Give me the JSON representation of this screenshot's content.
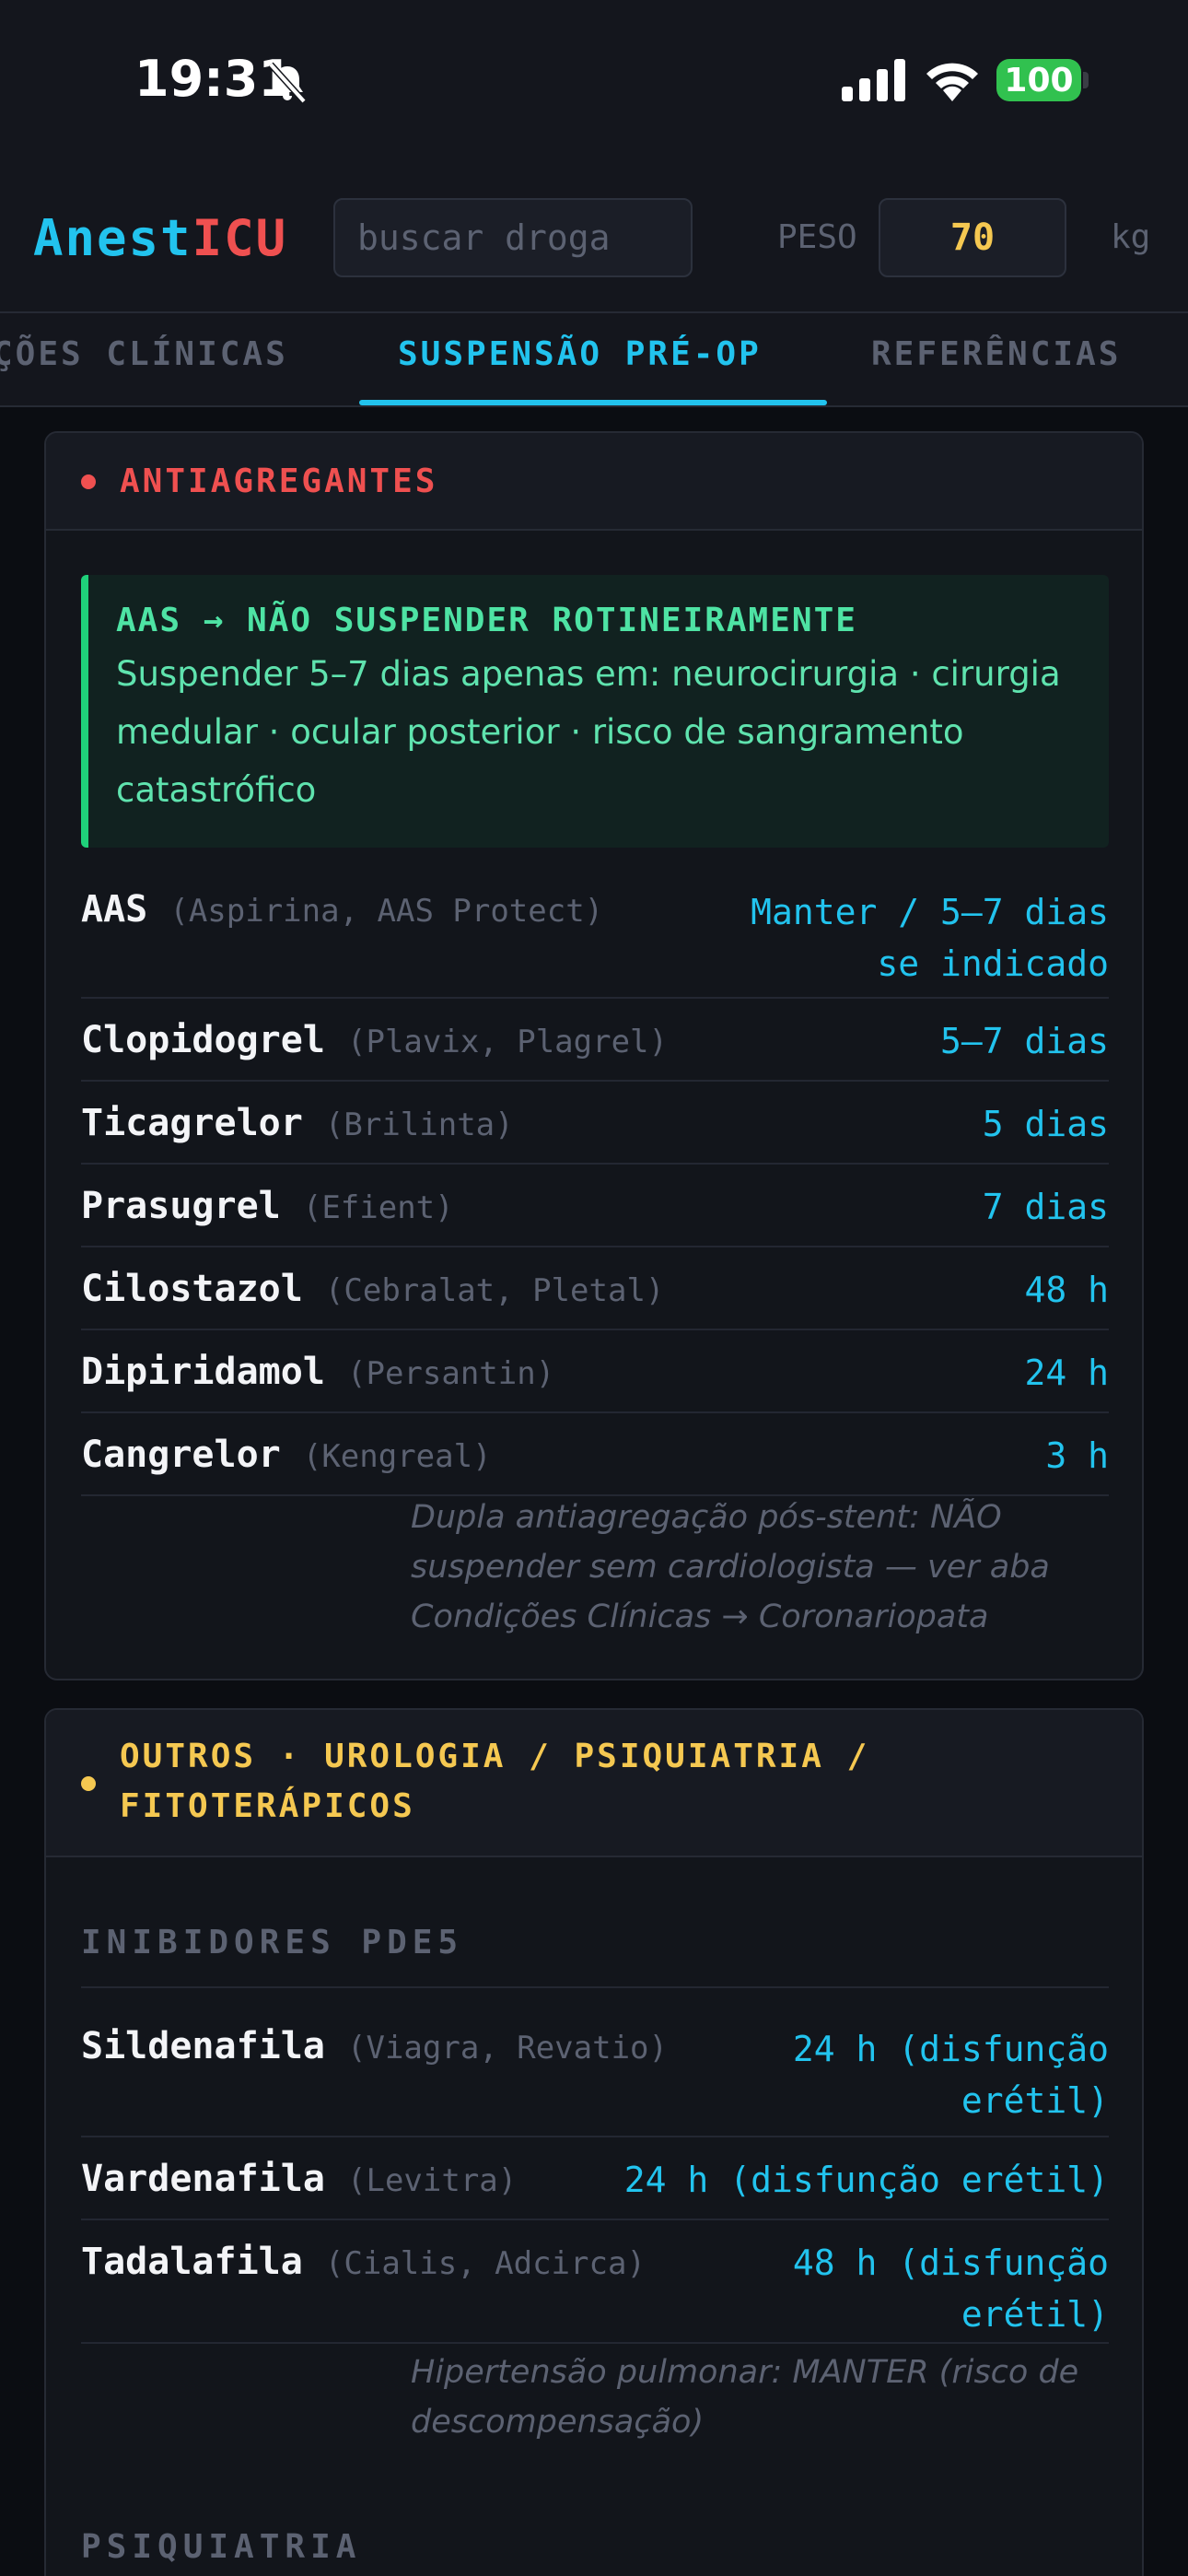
{
  "status_bar": {
    "time": "19:31",
    "battery": "100"
  },
  "header": {
    "logo_part1": "Anest",
    "logo_part2": "ICU",
    "search_placeholder": "buscar droga",
    "weight_label": "PESO",
    "weight_value": "70",
    "weight_unit": "kg"
  },
  "tabs": [
    {
      "label": "ÇÕES CLÍNICAS",
      "active": false
    },
    {
      "label": "SUSPENSÃO PRÉ-OP",
      "active": true
    },
    {
      "label": "REFERÊNCIAS",
      "active": false
    }
  ],
  "colors": {
    "accent": "#22c3ee",
    "red": "#ef5050",
    "yellow": "#f5c851",
    "green": "#1fd07a",
    "background": "#0b0d12"
  },
  "card1": {
    "title": "ANTIAGREGANTES",
    "alert_title": "AAS → NÃO SUSPENDER ROTINEIRAMENTE",
    "alert_text": "Suspender 5–7 dias apenas em: neurocirurgia · cirurgia medular · ocular posterior · risco de sangramento catastrófico",
    "rows": [
      {
        "drug": "AAS",
        "brand": "(Aspirina, AAS Protect)",
        "time_line1": "Manter / 5–7 dias",
        "time_line2": "se indicado"
      },
      {
        "drug": "Clopidogrel",
        "brand": "(Plavix, Plagrel)",
        "time": "5–7 dias"
      },
      {
        "drug": "Ticagrelor",
        "brand": "(Brilinta)",
        "time": "5 dias"
      },
      {
        "drug": "Prasugrel",
        "brand": "(Efient)",
        "time": "7 dias"
      },
      {
        "drug": "Cilostazol",
        "brand": "(Cebralat, Pletal)",
        "time": "48 h"
      },
      {
        "drug": "Dipiridamol",
        "brand": "(Persantin)",
        "time": "24 h"
      },
      {
        "drug": "Cangrelor",
        "brand": "(Kengreal)",
        "time": "3 h"
      }
    ],
    "note": "Dupla antiagregação pós-stent: NÃO suspender sem cardiologista — ver aba Condições Clínicas → Coronariopata"
  },
  "card2": {
    "title_line1": "OUTROS · UROLOGIA / PSIQUIATRIA /",
    "title_line2": "FITOTERÁPICOS",
    "section1": "INIBIDORES PDE5",
    "rows": [
      {
        "drug": "Sildenafila",
        "brand": "(Viagra, Revatio)",
        "time_line1": "24 h (disfunção",
        "time_line2": "erétil)"
      },
      {
        "drug": "Vardenafila",
        "brand": "(Levitra)",
        "time": "24 h (disfunção erétil)"
      },
      {
        "drug": "Tadalafila",
        "brand": "(Cialis, Adcirca)",
        "time_line1": "48 h (disfunção",
        "time_line2": "erétil)"
      }
    ],
    "note": "Hipertensão pulmonar: MANTER (risco de descompensação)",
    "section2": "PSIQUIATRIA"
  }
}
